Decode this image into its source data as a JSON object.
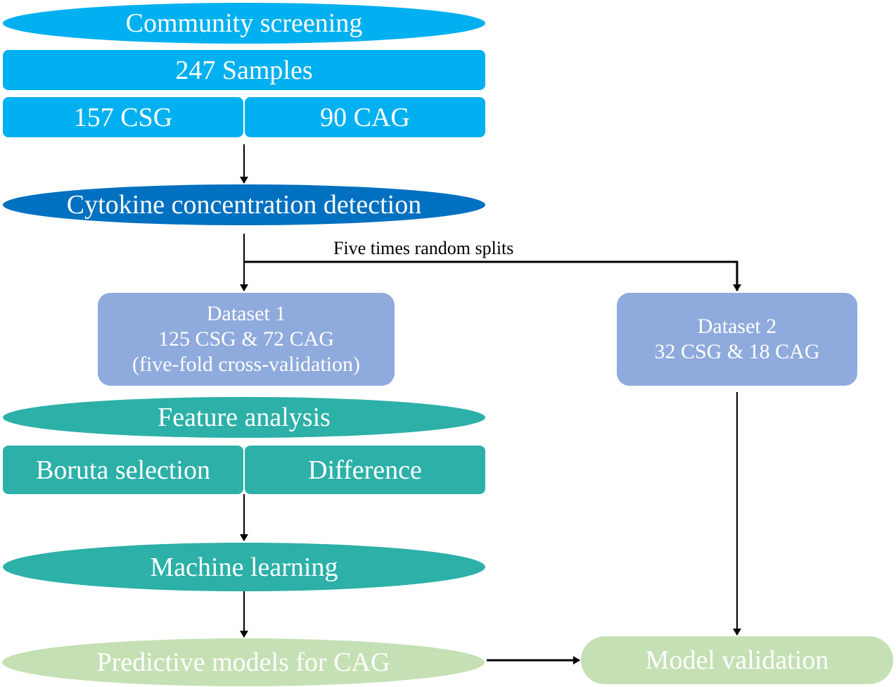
{
  "diagram": {
    "community_screening": "Community screening",
    "samples": "247 Samples",
    "csg_group": "157 CSG",
    "cag_group": "90 CAG",
    "cytokine_detection": "Cytokine concentration detection",
    "split_label": "Five times random splits",
    "dataset1": {
      "title": "Dataset 1",
      "counts": "125 CSG & 72 CAG",
      "note": "(five-fold cross-validation)"
    },
    "dataset2": {
      "title": "Dataset 2",
      "counts": "32 CSG & 18 CAG"
    },
    "feature_analysis": "Feature analysis",
    "boruta_selection": "Boruta selection",
    "difference": "Difference",
    "machine_learning": "Machine learning",
    "predictive_models": "Predictive models for CAG",
    "model_validation": "Model validation"
  },
  "colors": {
    "screening": "#00b0f0",
    "detection": "#0070c0",
    "dataset": "#8faadc",
    "analysis": "#2cb0a8",
    "output": "#c5e0b4"
  }
}
